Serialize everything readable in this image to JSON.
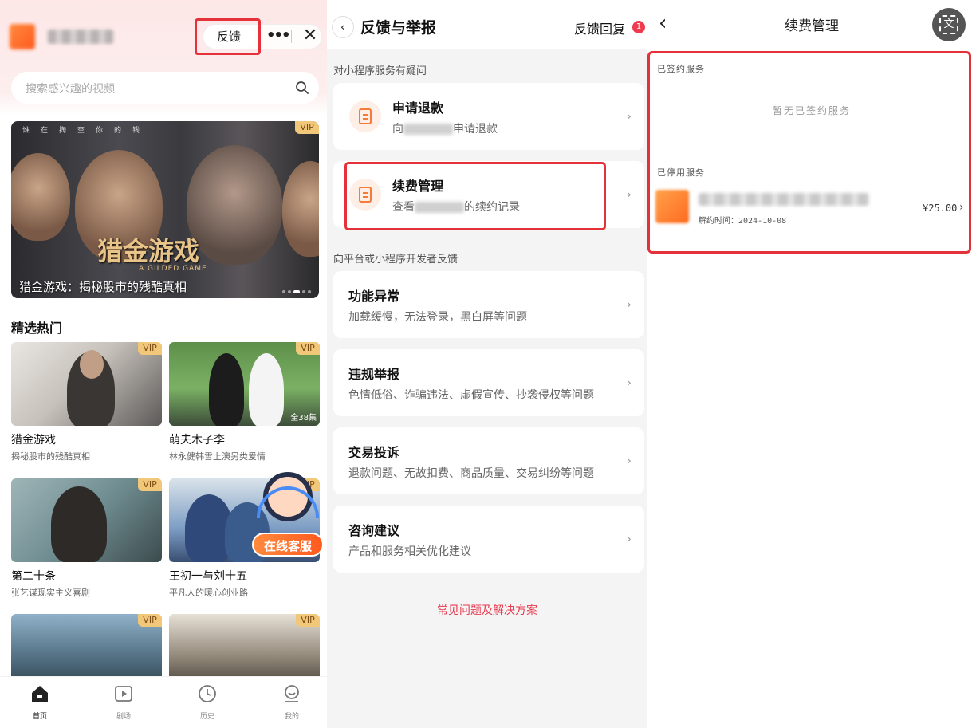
{
  "panel1": {
    "header": {
      "feedback_label": "反馈",
      "more_icon": "more-dots-icon",
      "close_icon": "close-icon"
    },
    "search": {
      "placeholder": "搜索感兴趣的视频"
    },
    "banner": {
      "vip": "VIP",
      "title_art": "猎金游戏",
      "title_en": "A GILDED GAME",
      "tagline": "谁在掏空你的钱",
      "caption": "猎金游戏：揭秘股市的残酷真相"
    },
    "section_title": "精选热门",
    "cards": [
      {
        "vip": "VIP",
        "title": "猎金游戏",
        "subtitle": "揭秘股市的残酷真相"
      },
      {
        "vip": "VIP",
        "title": "萌夫木子李",
        "subtitle": "林永健韩雪上演另类爱情",
        "episodes": "全38集"
      },
      {
        "vip": "VIP",
        "title": "第二十条",
        "subtitle": "张艺谋现实主义喜剧"
      },
      {
        "vip": "VIP",
        "title": "王初一与刘十五",
        "subtitle": "平凡人的暖心创业路"
      },
      {
        "vip": "VIP"
      },
      {
        "vip": "VIP"
      }
    ],
    "customer_service": "在线客服",
    "tabs": [
      {
        "label": "首页",
        "icon": "home-icon"
      },
      {
        "label": "剧场",
        "icon": "play-icon"
      },
      {
        "label": "历史",
        "icon": "clock-icon"
      },
      {
        "label": "我的",
        "icon": "user-icon"
      }
    ]
  },
  "panel2": {
    "title": "反馈与举报",
    "reply_label": "反馈回复",
    "reply_badge": "1",
    "section1": "对小程序服务有疑问",
    "refund": {
      "title": "申请退款",
      "desc_prefix": "向",
      "desc_suffix": "申请退款"
    },
    "renew": {
      "title": "续费管理",
      "desc_prefix": "查看",
      "desc_suffix": "的续约记录"
    },
    "section2": "向平台或小程序开发者反馈",
    "items": [
      {
        "title": "功能异常",
        "desc": "加载缓慢，无法登录，黑白屏等问题"
      },
      {
        "title": "违规举报",
        "desc": "色情低俗、诈骗违法、虚假宣传、抄袭侵权等问题"
      },
      {
        "title": "交易投诉",
        "desc": "退款问题、无故扣费、商品质量、交易纠纷等问题"
      },
      {
        "title": "咨询建议",
        "desc": "产品和服务相关优化建议"
      }
    ],
    "faq_link": "常见问题及解决方案"
  },
  "panel3": {
    "title": "续费管理",
    "signed_section": "已签约服务",
    "empty_text": "暂无已签约服务",
    "stopped_section": "已停用服务",
    "service": {
      "time_label": "解约时间：2024-10-08",
      "price": "¥25.00"
    }
  },
  "colors": {
    "highlight_red": "#e5323a",
    "accent_orange": "#ff6a1f",
    "badge_red": "#f03a4d",
    "link_red": "#e8394d"
  }
}
